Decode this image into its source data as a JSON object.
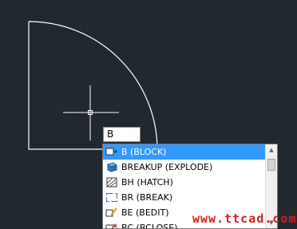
{
  "command_input": {
    "value": "B"
  },
  "autocomplete": {
    "items": [
      {
        "label": "B (BLOCK)",
        "icon": "block-insert-icon",
        "selected": true
      },
      {
        "label": "BREAKUP (EXPLODE)",
        "icon": "explode-icon",
        "selected": false
      },
      {
        "label": "BH (HATCH)",
        "icon": "hatch-icon",
        "selected": false
      },
      {
        "label": "BR (BREAK)",
        "icon": "break-icon",
        "selected": false
      },
      {
        "label": "BE (BEDIT)",
        "icon": "block-editor-icon",
        "selected": false
      },
      {
        "label": "BC (BCLOSE)",
        "icon": "block-close-icon",
        "selected": false
      }
    ],
    "scroll_up": "▲",
    "scroll_down": "▼"
  },
  "watermark": "www.ttcad.com",
  "colors": {
    "background": "#212830",
    "geometry": "#ffffff",
    "selection": "#3399ff",
    "watermark": "#d81c1c"
  }
}
